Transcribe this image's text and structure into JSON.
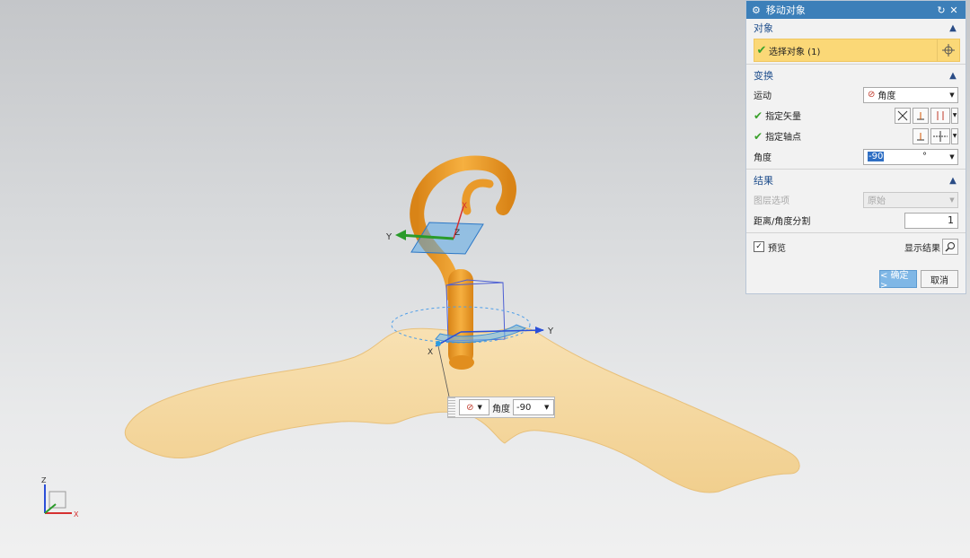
{
  "dialog": {
    "title": "移动对象",
    "sections": {
      "object": {
        "title": "对象",
        "select_label": "选择对象 (1)"
      },
      "transform": {
        "title": "变换",
        "motion_label": "运动",
        "motion_value": "角度",
        "vector_label": "指定矢量",
        "pivot_label": "指定轴点",
        "angle_label": "角度",
        "angle_value": "-90",
        "angle_unit": "°"
      },
      "result": {
        "title": "结果",
        "layer_label": "图层选项",
        "layer_value": "原始",
        "dist_label": "距离/角度分割",
        "dist_value": "1"
      }
    },
    "preview_label": "预览",
    "show_result_label": "显示结果",
    "ok_label": "< 确定 >",
    "cancel_label": "取消"
  },
  "mini_toolbar": {
    "angle_label": "角度",
    "angle_value": "-90"
  },
  "axes": {
    "x": "X",
    "y": "Y",
    "z": "Z"
  },
  "colors": {
    "accent": "#3c7fb9",
    "highlight": "#fbd877",
    "model_hook": "#f0a12c",
    "model_body": "#f4d9a6"
  }
}
